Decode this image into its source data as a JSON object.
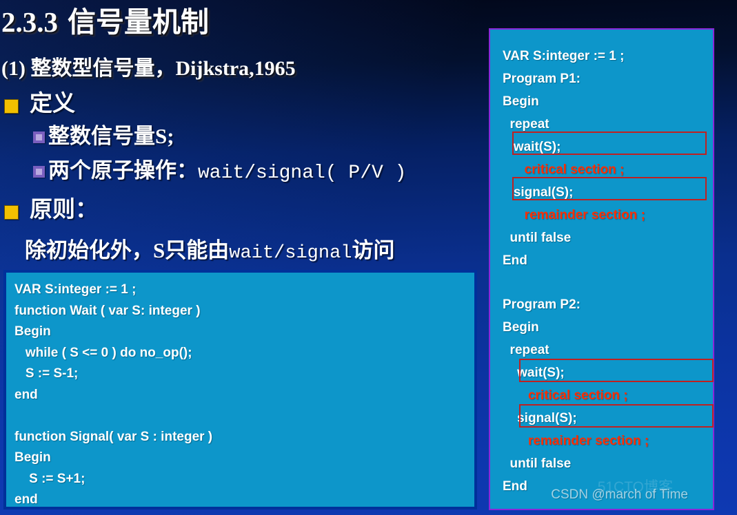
{
  "slide": {
    "title_number": "2.3.3",
    "title_text": "信号量机制",
    "subtitle": "(1) 整数型信号量，Dijkstra,1965",
    "background_top_color": "#020617",
    "background_bottom_color": "#0e39b2"
  },
  "bullets": [
    {
      "level": 1,
      "marker": "yellow-square-bullet",
      "text": "定义"
    },
    {
      "level": 2,
      "marker": "purple-hollow-square-bullet",
      "text": "整数信号量S;"
    },
    {
      "level": 2,
      "marker": "purple-hollow-square-bullet",
      "text_cn": "两个原子操作：",
      "text_mono": "wait/signal( P/V )"
    },
    {
      "level": 1,
      "marker": "yellow-square-bullet",
      "text": "原则："
    }
  ],
  "principle": {
    "prefix_cn": "除初始化外，S只能由",
    "mono": "wait/signal",
    "suffix_cn": "访问"
  },
  "left_code": {
    "box_fill": "#0d96ca",
    "box_border": "#00309a",
    "lines": [
      "VAR S:integer := 1 ;",
      "function Wait ( var S: integer )",
      "Begin",
      "   while ( S <= 0 ) do no_op();",
      "   S := S-1;",
      "end",
      "",
      "function Signal( var S : integer )",
      "Begin",
      "    S := S+1;",
      "end"
    ]
  },
  "right_code": {
    "box_fill": "#0d96ca",
    "box_border": "#8a27d8",
    "highlight_box_color": "#c02020",
    "red_text_color": "#ff2d00",
    "lines": [
      {
        "text": "VAR S:integer := 1 ;",
        "style": "white"
      },
      {
        "text": "Program P1:",
        "style": "white"
      },
      {
        "text": "Begin",
        "style": "white"
      },
      {
        "text": "  repeat",
        "style": "white"
      },
      {
        "text": "   wait(S);",
        "style": "white",
        "boxed": true
      },
      {
        "text": "      critical section ;",
        "style": "red"
      },
      {
        "text": "   signal(S);",
        "style": "white",
        "boxed": true
      },
      {
        "text": "      remainder section ;",
        "style": "red"
      },
      {
        "text": "  until false",
        "style": "white"
      },
      {
        "text": "End",
        "style": "white"
      },
      {
        "text": "",
        "style": "blank"
      },
      {
        "text": "Program P2:",
        "style": "white"
      },
      {
        "text": "Begin",
        "style": "white"
      },
      {
        "text": "  repeat",
        "style": "white"
      },
      {
        "text": "    wait(S);",
        "style": "white",
        "boxed": true
      },
      {
        "text": "       critical section ;",
        "style": "red"
      },
      {
        "text": "    signal(S);",
        "style": "white",
        "boxed": true
      },
      {
        "text": "       remainder section ;",
        "style": "red"
      },
      {
        "text": "  until false",
        "style": "white"
      },
      {
        "text": "End",
        "style": "white"
      }
    ]
  },
  "watermarks": {
    "csdn": "CSDN @march of Time",
    "site": "51CTO博客"
  }
}
